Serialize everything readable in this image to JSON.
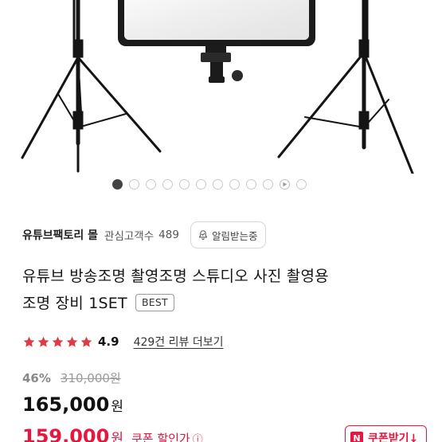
{
  "carousel": {
    "count": 12,
    "active_index": 0,
    "video_index": 10
  },
  "seller": {
    "name": "유튜브팩토리 몰",
    "subscribers_label": "관심고객수",
    "subscribers_count": "489",
    "notify_label": "알림받는중"
  },
  "product": {
    "title_line1": "유튜브 방송조명 촬영조명 스튜디오 사진 촬영용",
    "title_line2": "조명 장비 1SET",
    "badge": "BEST"
  },
  "rating": {
    "value": "4.9",
    "stars": 5,
    "reviews_link": "429건 리뷰 더보기"
  },
  "price": {
    "discount": "46%",
    "original": "310,000원",
    "sale": "165,000",
    "sale_unit": "원",
    "coupon_price": "159,000",
    "coupon_unit": "원",
    "coupon_label": "쿠폰 할인가",
    "coupon_info_icon": "ⓘ",
    "coupon_button": "쿠폰받기↓"
  },
  "colors": {
    "accent_red": "#e5173f",
    "star_red": "#e13a45"
  }
}
